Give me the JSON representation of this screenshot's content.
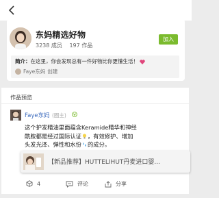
{
  "circle": {
    "name": "东妈精选好物",
    "members": "3238 成员",
    "works": "197 作品",
    "join_label": "加入",
    "intro_label": "简介：",
    "intro_text": "在这里，你会发现总有一件好物比你更懂生活！",
    "creator_name": "Faye东妈",
    "creator_suffix": "创建"
  },
  "section": {
    "title": "作品预览"
  },
  "post": {
    "author": "Faye东妈",
    "role": "(圈主)",
    "line1": "这个护发精油里面蕴含Keramide精华和神经",
    "line2a": "酰胺都是经过国际认证",
    "line2b": "，有效修护、增加",
    "line3a": "头发光泽、弹性和水份",
    "line3b": "的成分。"
  },
  "banner": {
    "text": "【新品推荐】HUTTELIHUT丹麦进口婴..."
  },
  "footer": {
    "likes": "4",
    "comment_label": "评论",
    "share_label": "分享"
  },
  "colors": {
    "accent_green": "#7bbb2e",
    "author_blue": "#3d6bbd"
  }
}
